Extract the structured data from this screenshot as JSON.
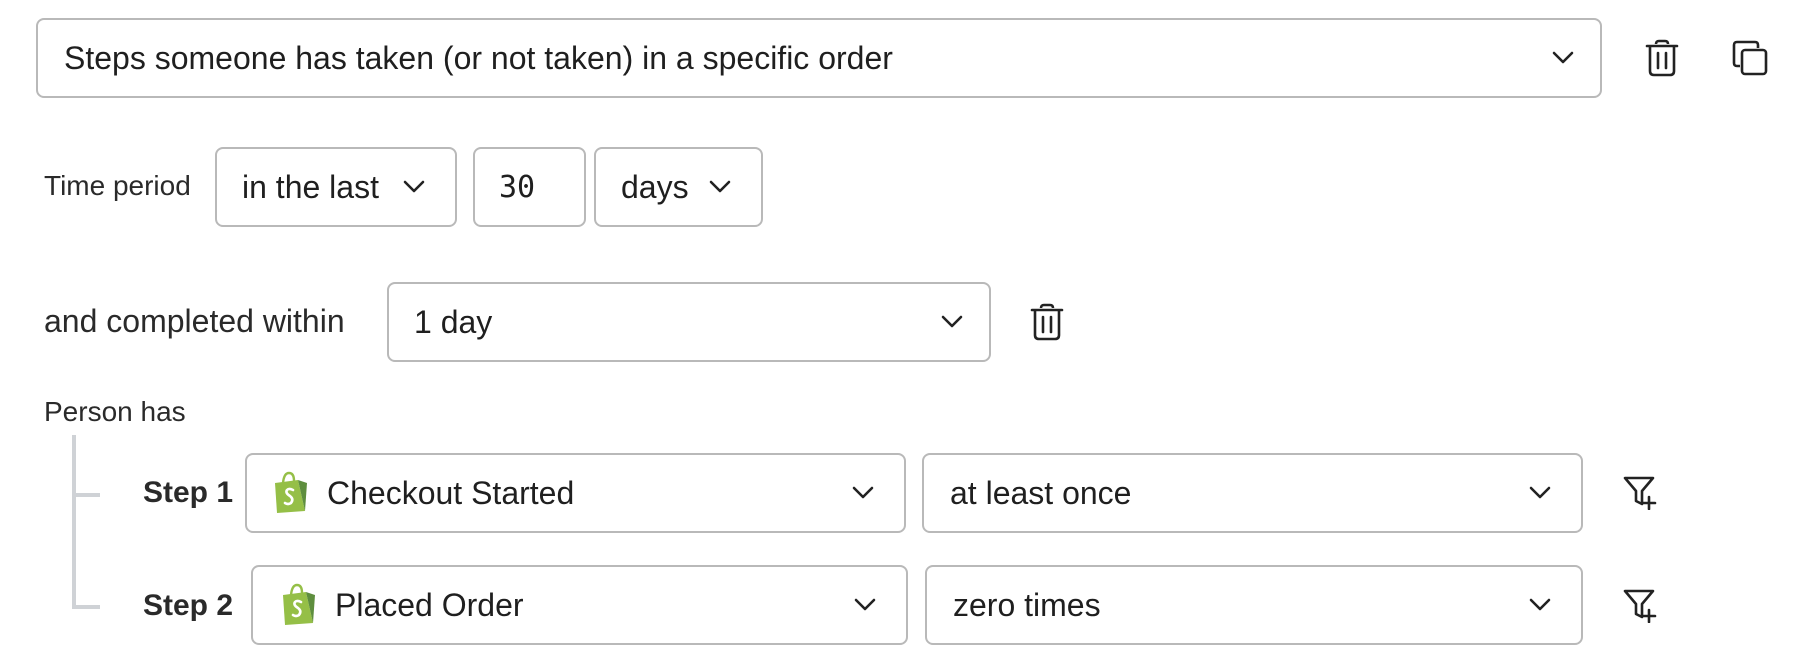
{
  "condition_type": {
    "value": "Steps someone has taken (or not taken) in a specific order"
  },
  "time_period": {
    "label": "Time period",
    "operator": "in the last",
    "amount": "30",
    "unit": "days"
  },
  "completed_within": {
    "label": "and completed within",
    "value": "1 day"
  },
  "person_has": {
    "label": "Person has"
  },
  "steps": [
    {
      "label": "Step 1",
      "event": "Checkout Started",
      "frequency": "at least once"
    },
    {
      "label": "Step 2",
      "event": "Placed Order",
      "frequency": "zero times"
    }
  ],
  "icons": {
    "delete": "trash-icon",
    "duplicate": "copy-icon",
    "filter": "filter-add-icon",
    "chevron": "chevron-down-icon",
    "shopify": "shopify-bag-icon"
  },
  "colors": {
    "border": "#b9b9b9",
    "tree_line": "#cfd2d6",
    "shopify_green": "#95bf47",
    "text": "#1f1f1f"
  }
}
